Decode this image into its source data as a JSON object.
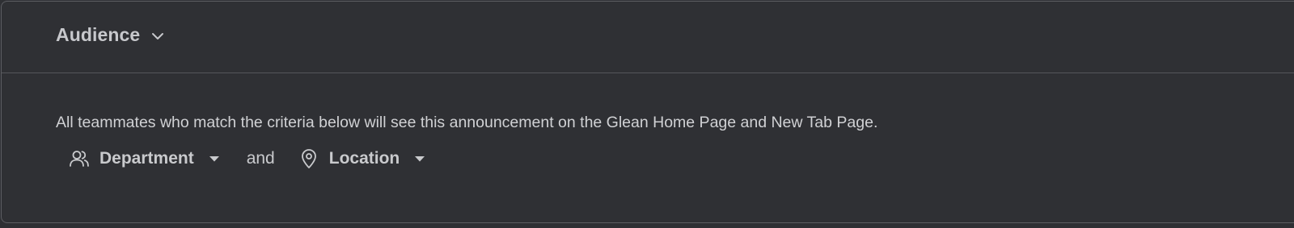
{
  "section": {
    "title": "Audience",
    "expand_icon": "chevron-down-icon"
  },
  "description": "All teammates who match the criteria below will see this announcement on the Glean Home Page and New Tab Page.",
  "criteria": {
    "department": {
      "label": "Department",
      "icon": "people-icon"
    },
    "conjunction": "and",
    "location": {
      "label": "Location",
      "icon": "map-pin-icon"
    }
  },
  "colors": {
    "background": "#2f3034",
    "border": "#55565b",
    "text": "#d0d1d4"
  }
}
